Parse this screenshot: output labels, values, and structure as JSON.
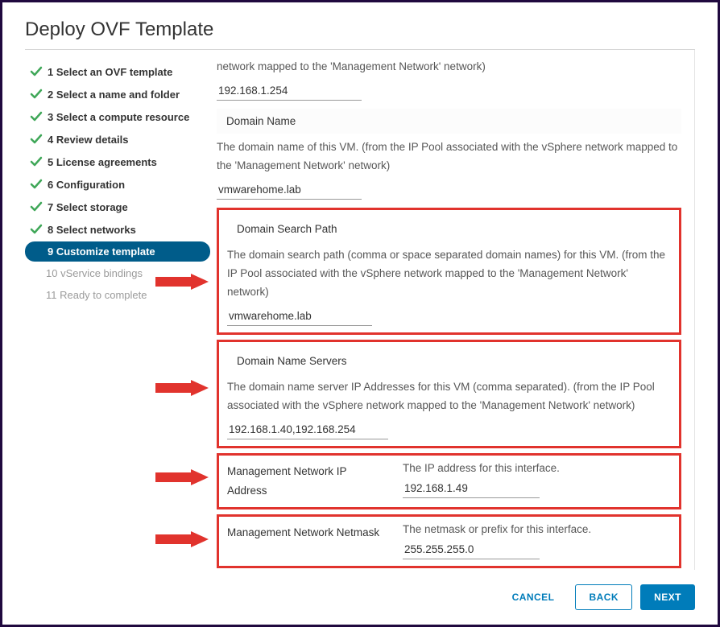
{
  "title": "Deploy OVF Template",
  "steps": [
    {
      "label": "1 Select an OVF template",
      "state": "done"
    },
    {
      "label": "2 Select a name and folder",
      "state": "done"
    },
    {
      "label": "3 Select a compute resource",
      "state": "done"
    },
    {
      "label": "4 Review details",
      "state": "done"
    },
    {
      "label": "5 License agreements",
      "state": "done"
    },
    {
      "label": "6 Configuration",
      "state": "done"
    },
    {
      "label": "7 Select storage",
      "state": "done"
    },
    {
      "label": "8 Select networks",
      "state": "done"
    },
    {
      "label": "9 Customize template",
      "state": "active"
    },
    {
      "label": "10 vService bindings",
      "state": "future"
    },
    {
      "label": "11 Ready to complete",
      "state": "future"
    }
  ],
  "top_desc": "network mapped to the 'Management Network' network)",
  "top_value": "192.168.1.254",
  "domain_name": {
    "label": "Domain Name",
    "desc": "The domain name of this VM. (from the IP Pool associated with the vSphere network mapped to the 'Management Network' network)",
    "value": "vmwarehome.lab"
  },
  "search_path": {
    "label": "Domain Search Path",
    "desc": "The domain search path (comma or space separated domain names) for this VM. (from the IP Pool associated with the vSphere network mapped to the 'Management Network' network)",
    "value": "vmwarehome.lab"
  },
  "dns": {
    "label": "Domain Name Servers",
    "desc": "The domain name server IP Addresses for this VM (comma separated). (from the IP Pool associated with the vSphere network mapped to the 'Management Network' network)",
    "value": "192.168.1.40,192.168.254"
  },
  "mgmt_ip": {
    "label": "Management Network IP Address",
    "desc": "The IP address for this interface.",
    "value": "192.168.1.49"
  },
  "mgmt_mask": {
    "label": "Management Network Netmask",
    "desc": "The netmask or prefix for this interface.",
    "value": "255.255.255.0"
  },
  "buttons": {
    "cancel": "CANCEL",
    "back": "BACK",
    "next": "NEXT"
  }
}
